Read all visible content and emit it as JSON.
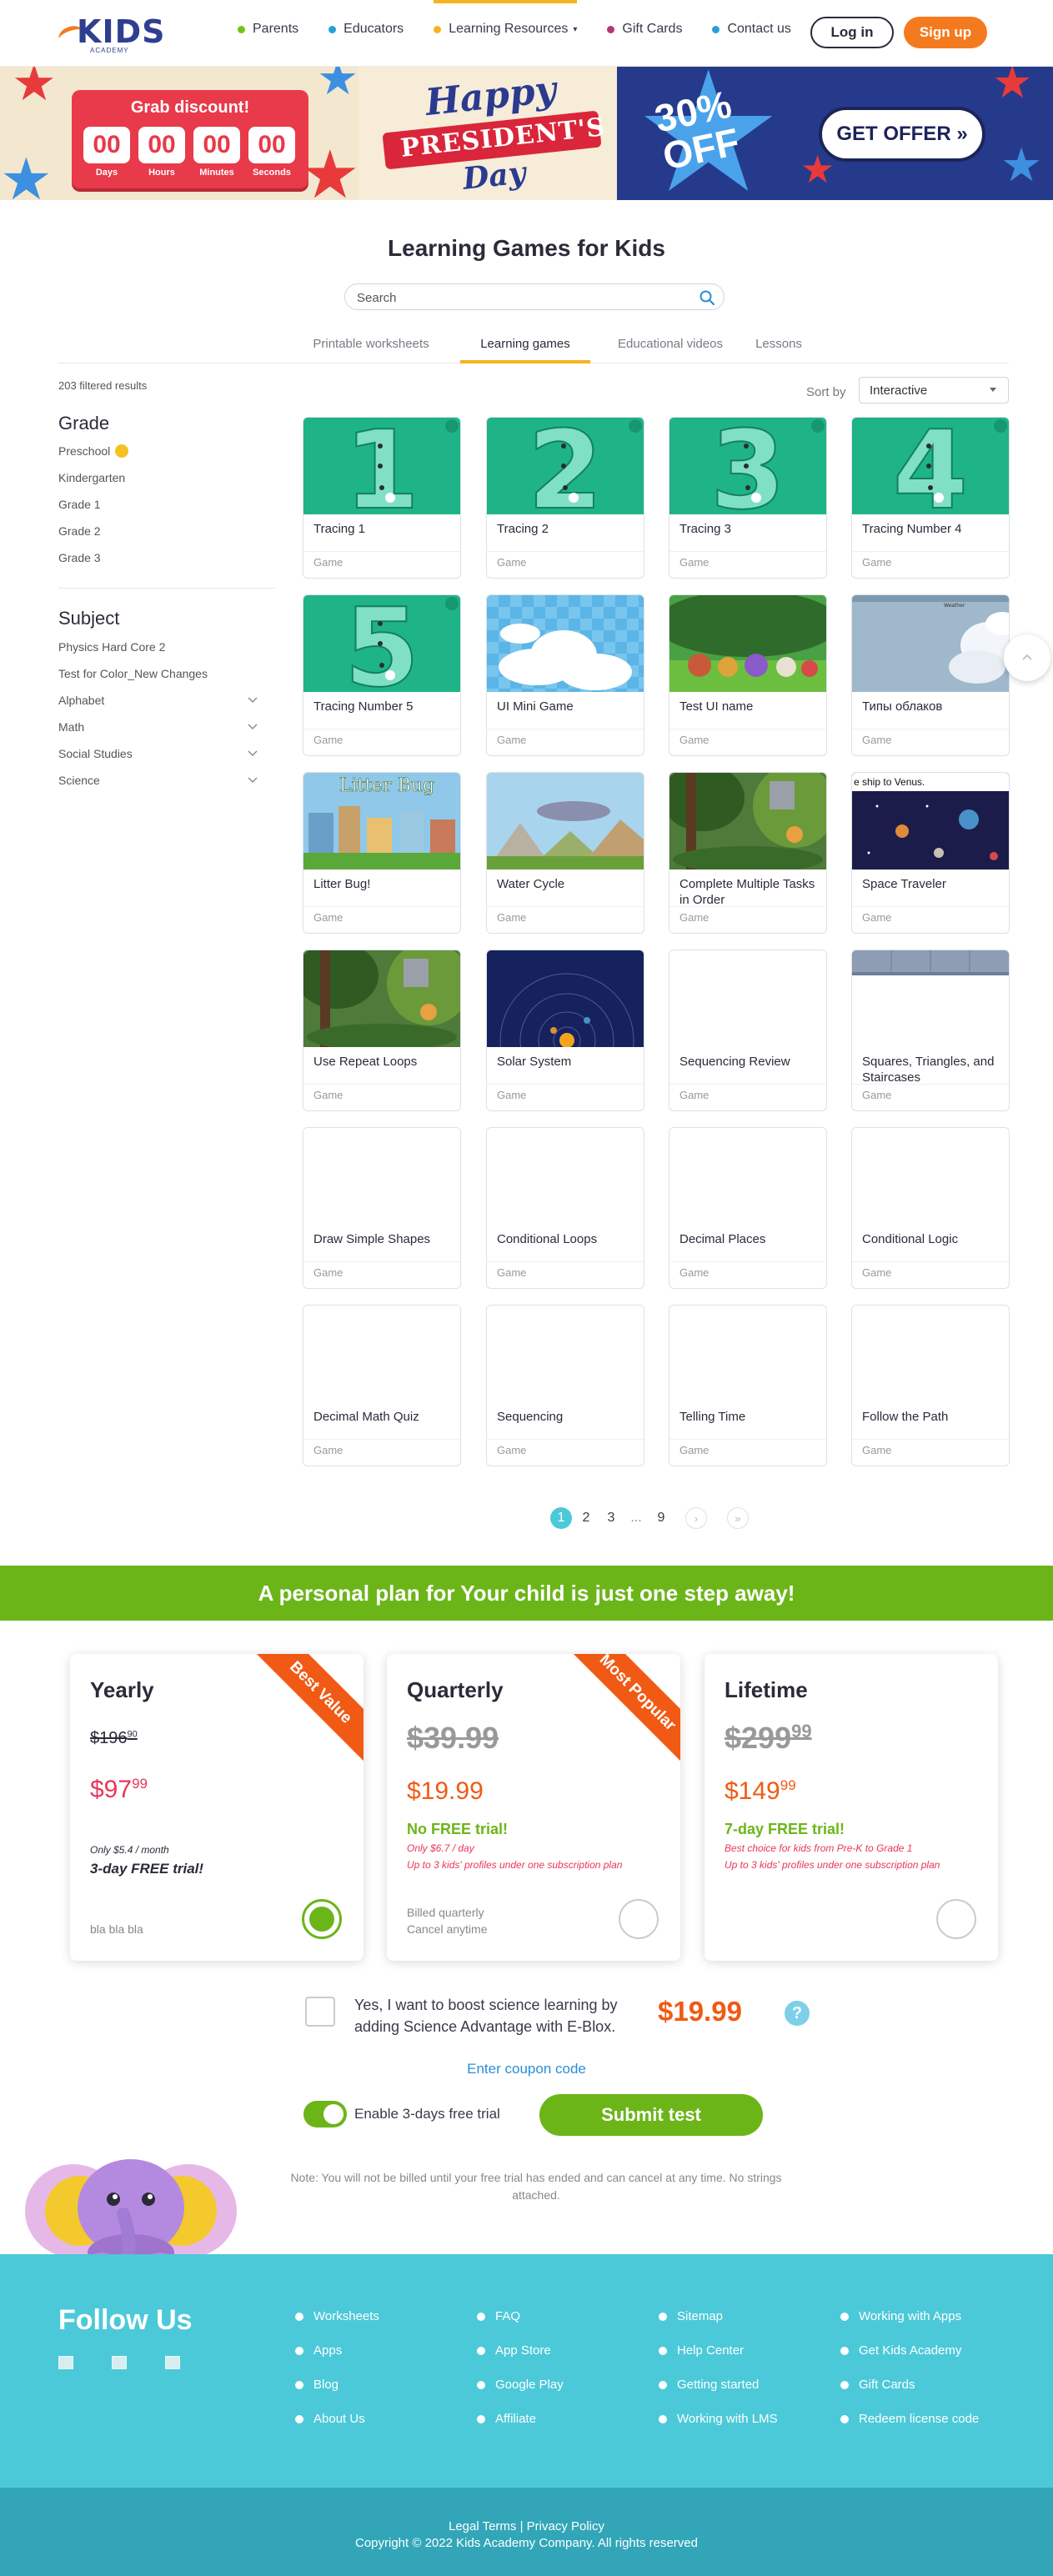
{
  "header": {
    "logo_text": "KIDS",
    "logo_sub": "ACADEMY",
    "nav": [
      {
        "label": "Parents",
        "color": "#7bbf1e"
      },
      {
        "label": "Educators",
        "color": "#2a9fd8"
      },
      {
        "label": "Learning Resources",
        "color": "#f5b41e",
        "has_caret": true
      },
      {
        "label": "Gift Cards",
        "color": "#b0387a"
      },
      {
        "label": "Contact us",
        "color": "#2a9fd8"
      }
    ],
    "login": "Log in",
    "signup": "Sign up"
  },
  "banner": {
    "grab": "Grab discount!",
    "countdown": [
      {
        "value": "00",
        "label": "Days"
      },
      {
        "value": "00",
        "label": "Hours"
      },
      {
        "value": "00",
        "label": "Minutes"
      },
      {
        "value": "00",
        "label": "Seconds"
      }
    ],
    "happy": "Happy",
    "presidents": "PRESIDENT'S",
    "day": "Day",
    "off_line1": "30%",
    "off_line2": "OFF",
    "cta": "GET OFFER »"
  },
  "page_title": "Learning Games for Kids",
  "search": {
    "placeholder": "Search"
  },
  "tabs": [
    {
      "label": "Printable worksheets",
      "active": false
    },
    {
      "label": "Learning games",
      "active": true
    },
    {
      "label": "Educational videos",
      "active": false
    },
    {
      "label": "Lessons",
      "active": false
    }
  ],
  "sidebar": {
    "filtered": "203 filtered results",
    "grade_heading": "Grade",
    "grades": [
      "Preschool",
      "Kindergarten",
      "Grade 1",
      "Grade 2",
      "Grade 3"
    ],
    "subject_heading": "Subject",
    "subjects": [
      {
        "label": "Physics Hard Core 2",
        "expandable": false
      },
      {
        "label": "Test for Color_New Changes",
        "expandable": false
      },
      {
        "label": "Alphabet",
        "expandable": true
      },
      {
        "label": "Math",
        "expandable": true
      },
      {
        "label": "Social Studies",
        "expandable": true
      },
      {
        "label": "Science",
        "expandable": true
      }
    ]
  },
  "sort": {
    "label": "Sort by",
    "value": "Interactive"
  },
  "cards": [
    {
      "title": "Tracing 1",
      "type": "Game",
      "thumb": "tracing",
      "digit": "1"
    },
    {
      "title": "Tracing 2",
      "type": "Game",
      "thumb": "tracing",
      "digit": "2"
    },
    {
      "title": "Tracing 3",
      "type": "Game",
      "thumb": "tracing",
      "digit": "3"
    },
    {
      "title": "Tracing Number 4",
      "type": "Game",
      "thumb": "tracing",
      "digit": "4"
    },
    {
      "title": "Tracing Number 5",
      "type": "Game",
      "thumb": "tracing",
      "digit": "5"
    },
    {
      "title": "UI Mini Game",
      "type": "Game",
      "thumb": "check"
    },
    {
      "title": "Test UI name",
      "type": "Game",
      "thumb": "forest"
    },
    {
      "title": "Типы облаков",
      "type": "Game",
      "thumb": "sky"
    },
    {
      "title": "Litter Bug!",
      "type": "Game",
      "thumb": "litter",
      "overlay": "Litter Bug"
    },
    {
      "title": "Water Cycle",
      "type": "Game",
      "thumb": "mountain"
    },
    {
      "title": "Complete Multiple Tasks in Order",
      "type": "Game",
      "thumb": "jungle"
    },
    {
      "title": "Space Traveler",
      "type": "Game",
      "thumb": "space",
      "overlay": "e ship to Venus."
    },
    {
      "title": "Use Repeat Loops",
      "type": "Game",
      "thumb": "jungle"
    },
    {
      "title": "Solar System",
      "type": "Game",
      "thumb": "solar"
    },
    {
      "title": "Sequencing Review",
      "type": "Game",
      "thumb": "grey"
    },
    {
      "title": "Squares, Triangles, and Staircases",
      "type": "Game",
      "thumb": "bar"
    },
    {
      "title": "Draw Simple Shapes",
      "type": "Game",
      "thumb": "grey"
    },
    {
      "title": "Conditional Loops",
      "type": "Game",
      "thumb": "grey"
    },
    {
      "title": "Decimal Places",
      "type": "Game",
      "thumb": "grey"
    },
    {
      "title": "Conditional Logic",
      "type": "Game",
      "thumb": "grey"
    },
    {
      "title": "Decimal Math Quiz",
      "type": "Game",
      "thumb": "grey"
    },
    {
      "title": "Sequencing",
      "type": "Game",
      "thumb": "grey"
    },
    {
      "title": "Telling Time",
      "type": "Game",
      "thumb": "grey"
    },
    {
      "title": "Follow the Path",
      "type": "Game",
      "thumb": "grey"
    }
  ],
  "pagination": {
    "pages": [
      "1",
      "2",
      "3",
      "...",
      "9"
    ],
    "current": "1",
    "next": "›",
    "last": "»"
  },
  "plan_bar": "A personal plan for Your child is just one step away!",
  "plans": [
    {
      "name": "Yearly",
      "ribbon": "Best Value",
      "old_main": "$196",
      "old_cents": "90",
      "new_main": "$97",
      "new_cents": "99",
      "line1": "Only $5.4 / month",
      "trial": "3-day FREE trial!",
      "foot1": "bla bla bla",
      "foot2": "",
      "selected": true
    },
    {
      "name": "Quarterly",
      "ribbon": "Most Popular",
      "old_main": "$39.99",
      "old_cents": "",
      "new_main": "$19.99",
      "new_cents": "",
      "trial": "No FREE trial!",
      "line1": "Only $6.7 / day",
      "line2": "Up to 3 kids' profiles under one subscription plan",
      "foot1": "Billed quarterly",
      "foot2": "Cancel anytime",
      "selected": false
    },
    {
      "name": "Lifetime",
      "ribbon": "",
      "old_main": "$299",
      "old_cents": "99",
      "new_main": "$149",
      "new_cents": "99",
      "trial": "7-day FREE trial!",
      "line1": "Best choice for kids from Pre-K to Grade 1",
      "line2": "Up to 3 kids' profiles under one subscription plan",
      "foot1": "",
      "foot2": "",
      "selected": false
    }
  ],
  "addon": {
    "text": "Yes, I want to boost science learning by adding Science Advantage with E-Blox.",
    "price": "$19.99",
    "help": "?"
  },
  "coupon": "Enter coupon code",
  "trial_toggle": "Enable 3-days free trial",
  "submit": "Submit test",
  "note": "Note: You will not be billed until your free trial has ended and can cancel at any time. No strings attached.",
  "footer": {
    "follow": "Follow Us",
    "columns": [
      [
        "Worksheets",
        "Apps",
        "Blog",
        "About Us"
      ],
      [
        "FAQ",
        "App Store",
        "Google Play",
        "Affiliate"
      ],
      [
        "Sitemap",
        "Help Center",
        "Getting started",
        "Working with LMS"
      ],
      [
        "Working with Apps",
        "Get Kids Academy",
        "Gift Cards",
        "Redeem license code"
      ]
    ],
    "legal": "Legal Terms | Privacy Policy",
    "copyright": "Copyright © 2022 Kids Academy Company. All rights reserved"
  },
  "colors": {
    "accent_green": "#6cb519",
    "accent_orange": "#f47a20",
    "teal": "#4cc9d8"
  }
}
